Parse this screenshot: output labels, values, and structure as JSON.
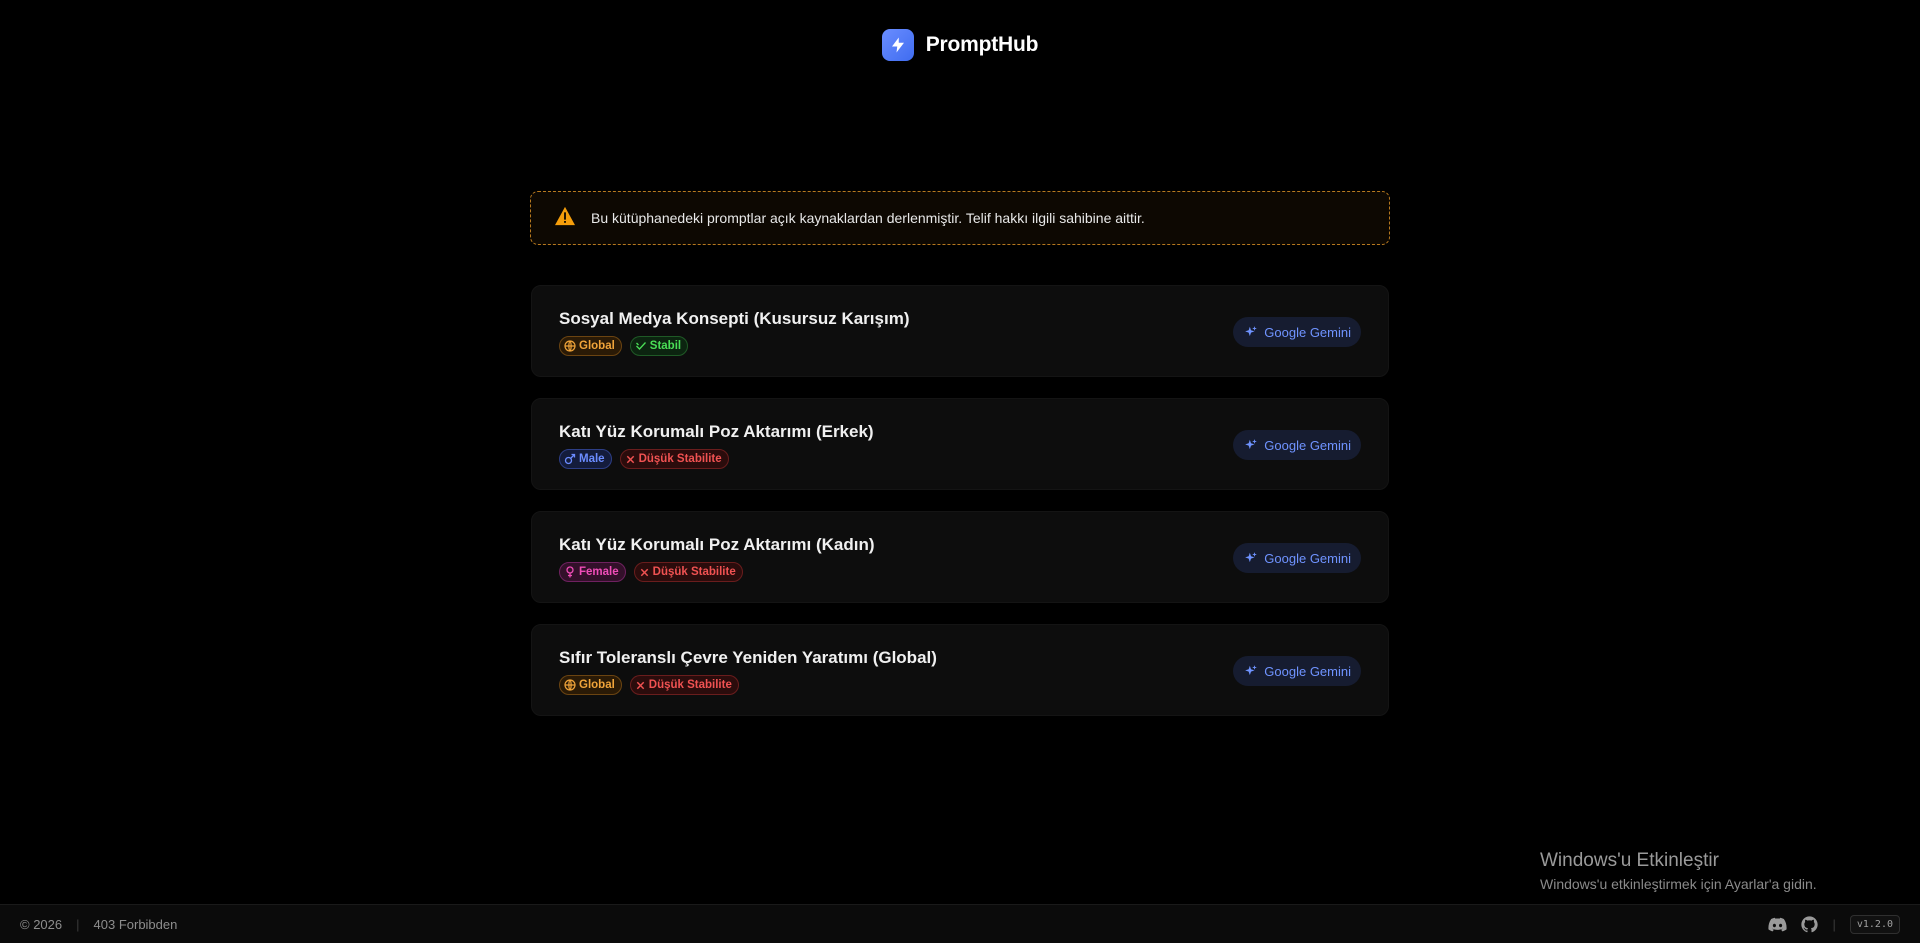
{
  "brand": {
    "name": "PromptHub",
    "icon": "bolt-icon"
  },
  "notice": {
    "icon": "warning-icon",
    "text": "Bu kütüphanedeki promptlar açık kaynaklardan derlenmiştir. Telif hakkı ilgili sahibine aittir."
  },
  "cards": [
    {
      "title": "Sosyal Medya Konsepti (Kusursuz Karışım)",
      "tags": [
        {
          "label": "Global",
          "kind": "global",
          "icon": "globe-icon"
        },
        {
          "label": "Stabil",
          "kind": "stable",
          "icon": "check-badge-icon"
        }
      ],
      "button": "Google Gemini"
    },
    {
      "title": "Katı Yüz Korumalı Poz Aktarımı (Erkek)",
      "tags": [
        {
          "label": "Male",
          "kind": "male",
          "icon": "male-icon"
        },
        {
          "label": "Düşük Stabilite",
          "kind": "low",
          "icon": "x-icon"
        }
      ],
      "button": "Google Gemini"
    },
    {
      "title": "Katı Yüz Korumalı Poz Aktarımı (Kadın)",
      "tags": [
        {
          "label": "Female",
          "kind": "female",
          "icon": "female-icon"
        },
        {
          "label": "Düşük Stabilite",
          "kind": "low",
          "icon": "x-icon"
        }
      ],
      "button": "Google Gemini"
    },
    {
      "title": "Sıfır Toleranslı Çevre Yeniden Yaratımı (Global)",
      "tags": [
        {
          "label": "Global",
          "kind": "global",
          "icon": "globe-icon"
        },
        {
          "label": "Düşük Stabilite",
          "kind": "low",
          "icon": "x-icon"
        }
      ],
      "button": "Google Gemini"
    }
  ],
  "watermark": {
    "title": "Windows'u Etkinleştir",
    "subtitle": "Windows'u etkinleştirmek için Ayarlar'a gidin."
  },
  "footer": {
    "copyright": "© 2026",
    "status": "403 Forbibden",
    "discord_icon": "discord-icon",
    "github_icon": "github-icon",
    "version": "v1.2.0"
  },
  "colors": {
    "background": "#000000",
    "accent": "#6f93ff",
    "warning": "#f59e0b",
    "global": "#f0a43a",
    "stable": "#4ade56",
    "male": "#6b8cff",
    "female": "#f04db8",
    "low": "#f05252"
  }
}
